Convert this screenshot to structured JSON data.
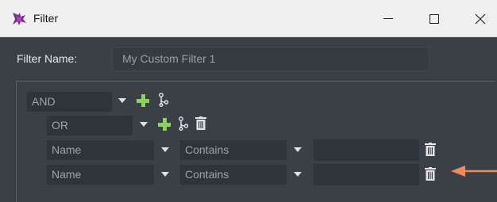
{
  "window": {
    "title": "Filter",
    "controls": {
      "minimize": "–",
      "maximize": "□",
      "close": "✕"
    }
  },
  "filter_name": {
    "label": "Filter Name:",
    "value": "My Custom Filter 1"
  },
  "groups": {
    "root": {
      "operator": "AND",
      "icons": [
        "plus-icon",
        "branch-icon"
      ]
    },
    "sub": {
      "operator": "OR",
      "icons": [
        "plus-icon",
        "branch-icon",
        "trash-icon"
      ]
    }
  },
  "conditions": [
    {
      "field": "Name",
      "operator": "Contains",
      "value": ""
    },
    {
      "field": "Name",
      "operator": "Contains",
      "value": ""
    }
  ],
  "colors": {
    "window_bg": "#3b4047",
    "input_bg": "#2f343a",
    "plus_green": "#8cd35a",
    "annotation_arrow": "#f08a5d",
    "titlebar_bg": "#f0f0f0"
  }
}
